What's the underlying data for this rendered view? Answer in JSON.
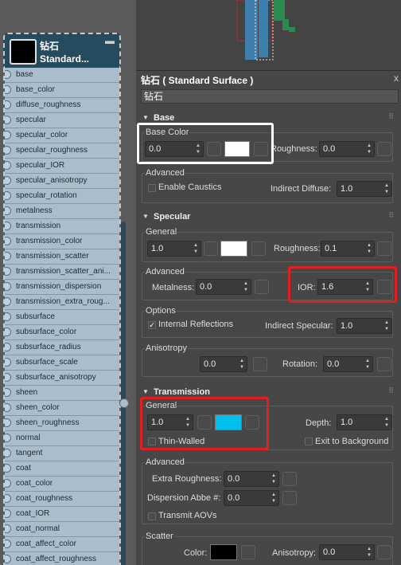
{
  "node": {
    "title": "钻石",
    "subtitle": "Standard...",
    "params": [
      "base",
      "base_color",
      "diffuse_roughness",
      "specular",
      "specular_color",
      "specular_roughness",
      "specular_IOR",
      "specular_anisotropy",
      "specular_rotation",
      "metalness",
      "transmission",
      "transmission_color",
      "transmission_scatter",
      "transmission_scatter_ani...",
      "transmission_dispersion",
      "transmission_extra_roug...",
      "subsurface",
      "subsurface_color",
      "subsurface_radius",
      "subsurface_scale",
      "subsurface_anisotropy",
      "sheen",
      "sheen_color",
      "sheen_roughness",
      "normal",
      "tangent",
      "coat",
      "coat_color",
      "coat_roughness",
      "coat_IOR",
      "coat_normal",
      "coat_affect_color",
      "coat_affect_roughness"
    ]
  },
  "panel": {
    "title": "钻石 ( Standard Surface )",
    "close": "x",
    "name": "钻石"
  },
  "base": {
    "header": "Base",
    "group_label": "Base Color",
    "weight": "0.0",
    "roughness_label": "Roughness:",
    "roughness": "0.0",
    "advanced_label": "Advanced",
    "enable_caustics": "Enable Caustics",
    "indirect_diffuse_label": "Indirect Diffuse:",
    "indirect_diffuse": "1.0",
    "color": "#ffffff"
  },
  "specular": {
    "header": "Specular",
    "general_label": "General",
    "weight": "1.0",
    "roughness_label": "Roughness:",
    "roughness": "0.1",
    "advanced_label": "Advanced",
    "metalness_label": "Metalness:",
    "metalness": "0.0",
    "ior_label": "IOR:",
    "ior": "1.6",
    "options_label": "Options",
    "internal_reflections": "Internal Reflections",
    "indirect_specular_label": "Indirect Specular:",
    "indirect_specular": "1.0",
    "anisotropy_label": "Anisotropy",
    "anisotropy": "0.0",
    "rotation_label": "Rotation:",
    "rotation": "0.0",
    "color": "#ffffff"
  },
  "transmission": {
    "header": "Transmission",
    "general_label": "General",
    "weight": "1.0",
    "depth_label": "Depth:",
    "depth": "1.0",
    "thin_walled": "Thin-Walled",
    "exit_to_background": "Exit to Background",
    "advanced_label": "Advanced",
    "extra_roughness_label": "Extra Roughness:",
    "extra_roughness": "0.0",
    "dispersion_label": "Dispersion Abbe #:",
    "dispersion": "0.0",
    "transmit_aovs": "Transmit AOVs",
    "scatter_label": "Scatter",
    "color_label": "Color:",
    "anisotropy_label": "Anisotropy:",
    "anisotropy": "0.0",
    "color": "#00c0f0"
  },
  "colors": {
    "highlight_white": "#ffffff",
    "highlight_red": "#e02020",
    "node_header": "#264a5e",
    "param_row": "#a9bdcd"
  }
}
